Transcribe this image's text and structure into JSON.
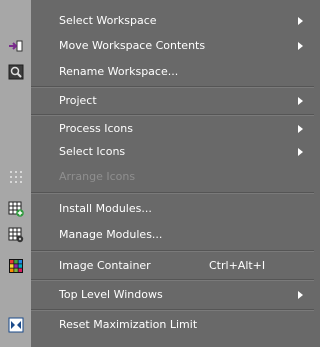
{
  "menu": {
    "items": [
      {
        "label": "Select Workspace",
        "submenu": true
      },
      {
        "label": "Move Workspace Contents",
        "submenu": true,
        "icon": "move-workspace-icon"
      },
      {
        "label": "Rename Workspace...",
        "icon": "rename-workspace-icon"
      },
      {
        "label": "Project",
        "submenu": true
      },
      {
        "label": "Process Icons",
        "submenu": true
      },
      {
        "label": "Select Icons",
        "submenu": true
      },
      {
        "label": "Arrange Icons",
        "disabled": true,
        "icon": "arrange-icons-icon"
      },
      {
        "label": "Install Modules...",
        "icon": "install-modules-icon"
      },
      {
        "label": "Manage Modules...",
        "icon": "manage-modules-icon"
      },
      {
        "label": "Image Container",
        "shortcut": "Ctrl+Alt+I",
        "icon": "image-container-icon"
      },
      {
        "label": "Top Level Windows",
        "submenu": true
      },
      {
        "label": "Reset Maximization Limit",
        "icon": "reset-maximization-icon"
      }
    ]
  },
  "colors": {
    "menu_bg": "#696969",
    "gutter_bg": "#a7a7a7",
    "text": "#ffffff",
    "disabled_text": "#8f8f8f"
  }
}
